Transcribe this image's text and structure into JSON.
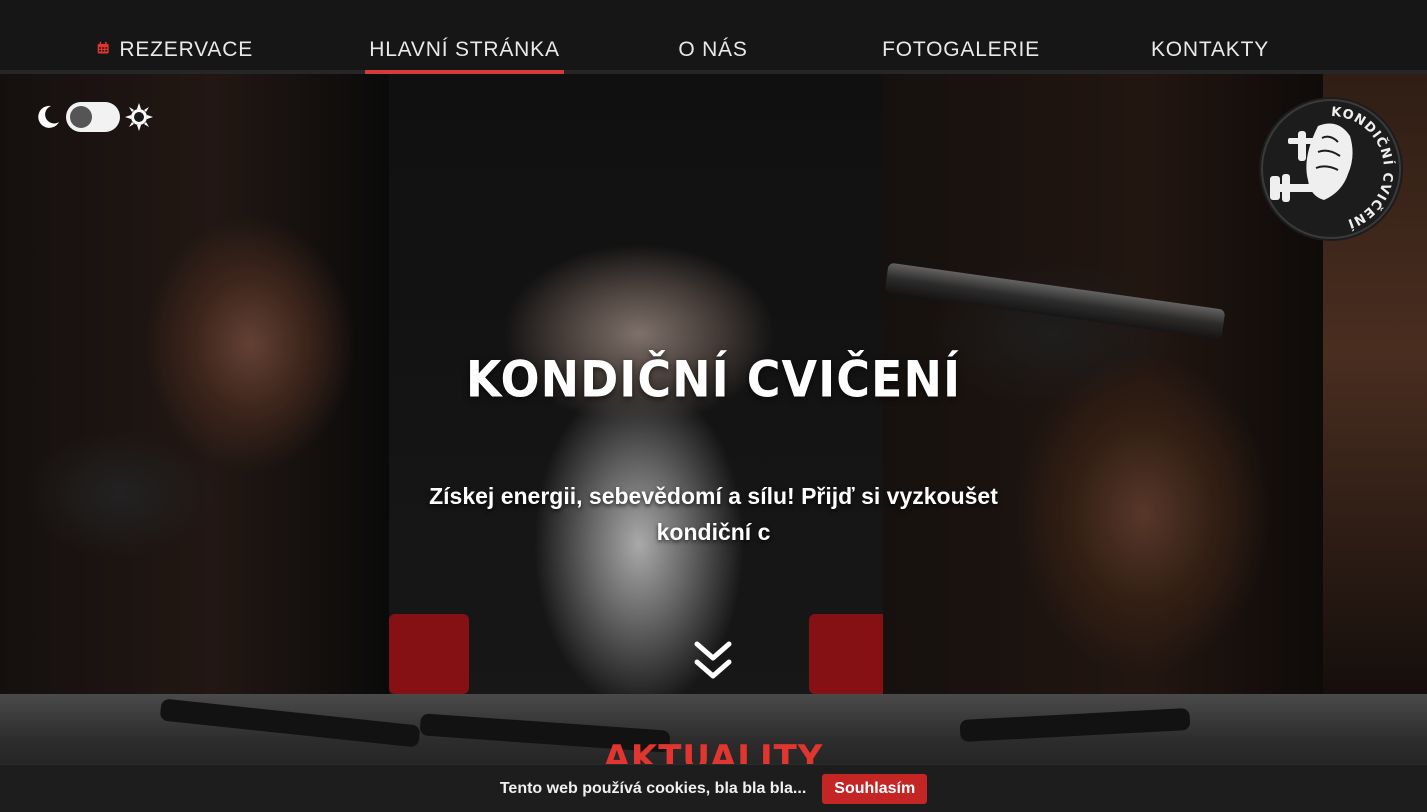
{
  "nav": {
    "items": [
      {
        "label": "REZERVACE",
        "icon": "calendar-icon",
        "active": false
      },
      {
        "label": "HLAVNÍ STRÁNKA",
        "active": true
      },
      {
        "label": "O NÁS",
        "active": false
      },
      {
        "label": "FOTOGALERIE",
        "active": false
      },
      {
        "label": "KONTAKTY",
        "active": false
      }
    ],
    "active_color": "#d63b3b"
  },
  "theme_toggle": {
    "left_icon": "moon-icon",
    "right_icon": "sun-icon"
  },
  "logo": {
    "text": "KONDIČNÍ CVIČENÍ",
    "icon": "lion-dumbbell-logo"
  },
  "hero": {
    "title": "KONDIČNÍ CVIČENÍ",
    "subtitle": "Získej energii, sebevědomí a sílu! Přijď si vyzkoušet kondiční c",
    "scroll_icon": "double-chevron-down-icon"
  },
  "news": {
    "title": "AKTUALITY",
    "color": "#e0362f"
  },
  "cookie": {
    "text": "Tento web používá cookies, bla bla bla...",
    "button": "Souhlasím",
    "button_color": "#c42525"
  }
}
